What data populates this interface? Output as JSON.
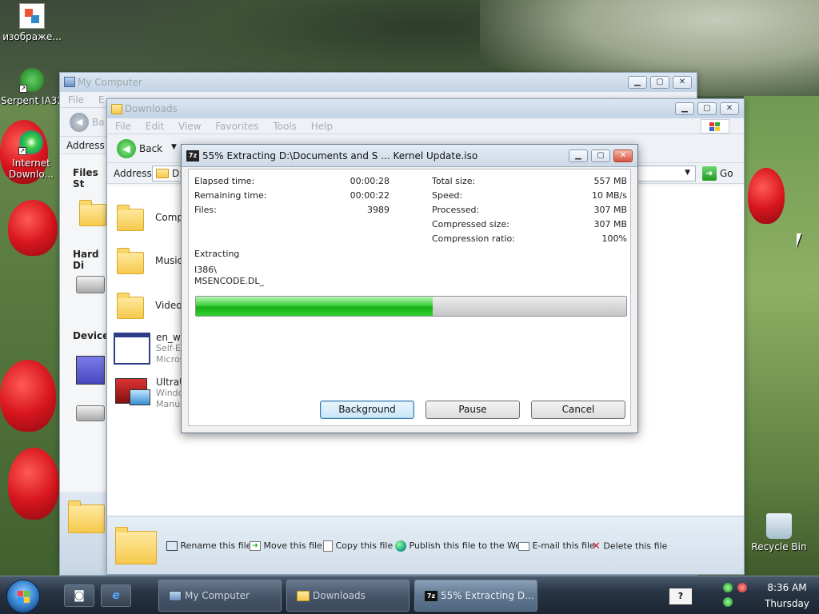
{
  "desktop": {
    "icons": [
      {
        "label": "изображе...",
        "icon": "paint-image-icon"
      },
      {
        "label": "Serpent IA32",
        "icon": "serpent-icon"
      },
      {
        "label": "Internet Downlo...",
        "icon": "internet-download-manager-icon"
      },
      {
        "label": "Recycle Bin",
        "icon": "recycle-bin-icon"
      }
    ]
  },
  "my_computer": {
    "title": "My Computer",
    "menu": [
      "File",
      "E"
    ],
    "back": "Ba",
    "address_label": "Address",
    "sections": [
      "Files St",
      "Hard Di",
      "Devices"
    ]
  },
  "downloads": {
    "title": "Downloads",
    "menu": [
      "File",
      "Edit",
      "View",
      "Favorites",
      "Tools",
      "Help"
    ],
    "back": "Back",
    "address_label": "Address",
    "address_value": "D:",
    "go": "Go",
    "items": [
      {
        "name": "Comp",
        "type": "folder"
      },
      {
        "name": "Music",
        "type": "folder"
      },
      {
        "name": "Video",
        "type": "folder"
      },
      {
        "name": "en_wi",
        "line2": "Self-E",
        "line3": "Micros",
        "type": "exe"
      },
      {
        "name": "UltraU",
        "line2": "Windo",
        "line3": "Manu",
        "type": "app"
      }
    ],
    "tasks": [
      {
        "label": "Rename this file",
        "icon": "rename-icon"
      },
      {
        "label": "Move this file",
        "icon": "move-icon"
      },
      {
        "label": "Copy this file",
        "icon": "copy-icon"
      },
      {
        "label": "Publish this file to the Web",
        "icon": "globe-icon"
      },
      {
        "label": "E-mail this file",
        "icon": "email-icon"
      },
      {
        "label": "Delete this file",
        "icon": "delete-icon"
      }
    ]
  },
  "dialog": {
    "title": "55% Extracting D:\\Documents and S ... Kernel Update.iso",
    "progress_percent": 55,
    "left_stats": [
      {
        "label": "Elapsed time:",
        "value": "00:00:28"
      },
      {
        "label": "Remaining time:",
        "value": "00:00:22"
      },
      {
        "label": "Files:",
        "value": "3989"
      }
    ],
    "right_stats": [
      {
        "label": "Total size:",
        "value": "557 MB"
      },
      {
        "label": "Speed:",
        "value": "10 MB/s"
      },
      {
        "label": "Processed:",
        "value": "307 MB"
      },
      {
        "label": "Compressed size:",
        "value": "307 MB"
      },
      {
        "label": "Compression ratio:",
        "value": "100%"
      }
    ],
    "status_label": "Extracting",
    "current_path": "I386\\",
    "current_file": "MSENCODE.DL_",
    "buttons": {
      "background": "Background",
      "pause": "Pause",
      "cancel": "Cancel"
    }
  },
  "taskbar": {
    "tasks": [
      {
        "label": "My Computer"
      },
      {
        "label": "Downloads"
      },
      {
        "label": "55% Extracting D..."
      }
    ],
    "clock_time": "8:36 AM",
    "clock_day": "Thursday"
  },
  "colors": {
    "accent": "#3ed13e",
    "close": "#d8523c",
    "taskbar": "#283544"
  }
}
